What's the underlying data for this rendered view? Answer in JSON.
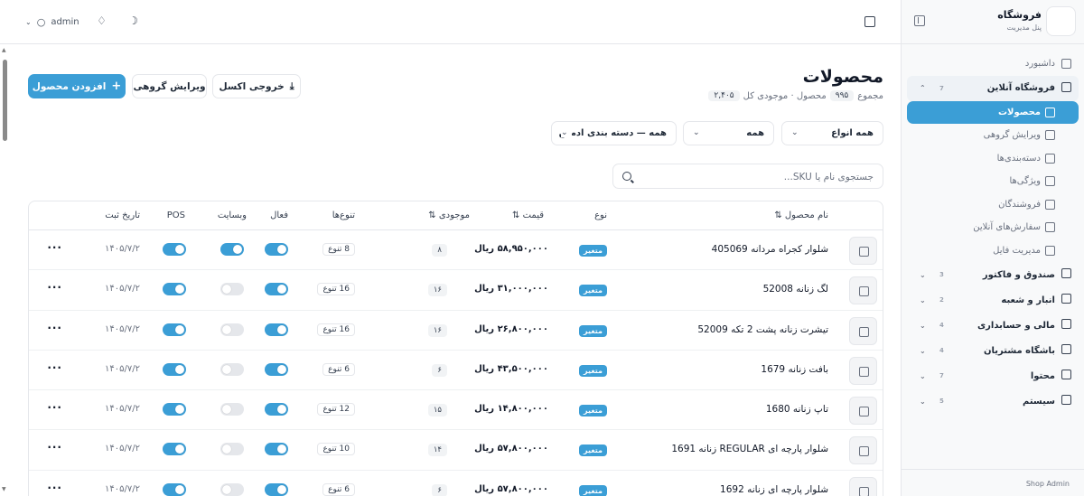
{
  "sidebar": {
    "title": "فروشگاه",
    "subtitle": "پنل مدیریت",
    "footer": "Shop Admin",
    "items": [
      {
        "label": "داشبورد",
        "kind": "top",
        "icon": "dashboard-icon"
      },
      {
        "label": "فروشگاه آنلاین",
        "kind": "group-open",
        "count": "7",
        "icon": "store-icon"
      },
      {
        "label": "محصولات",
        "kind": "active",
        "icon": "box-icon"
      },
      {
        "label": "ویرایش گروهی",
        "kind": "sub",
        "icon": "table-icon"
      },
      {
        "label": "دسته‌بندی‌ها",
        "kind": "sub",
        "icon": "layers-icon"
      },
      {
        "label": "ویژگی‌ها",
        "kind": "sub",
        "icon": "sliders-icon"
      },
      {
        "label": "فروشندگان",
        "kind": "sub",
        "icon": "vendor-icon"
      },
      {
        "label": "سفارش‌های آنلاین",
        "kind": "sub",
        "icon": "cart-icon"
      },
      {
        "label": "مدیریت فایل",
        "kind": "sub",
        "icon": "folder-icon"
      },
      {
        "label": "صندوق و فاکتور",
        "kind": "group",
        "count": "3",
        "icon": "receipt-icon"
      },
      {
        "label": "انبار و شعبه",
        "kind": "group",
        "count": "2",
        "icon": "warehouse-icon"
      },
      {
        "label": "مالی و حسابداری",
        "kind": "group",
        "count": "4",
        "icon": "bank-icon"
      },
      {
        "label": "باشگاه مشتریان",
        "kind": "group",
        "count": "4",
        "icon": "gift-icon"
      },
      {
        "label": "محتوا",
        "kind": "group",
        "count": "7",
        "icon": "document-icon"
      },
      {
        "label": "سیستم",
        "kind": "group",
        "count": "5",
        "icon": "gear-icon"
      }
    ]
  },
  "topbar": {
    "user": "admin"
  },
  "page": {
    "title": "محصولات",
    "summary_prefix": "مجموع",
    "product_count": "۹۹۵",
    "summary_mid": "محصول · موجودی کل",
    "stock_total": "۲,۴۰۵"
  },
  "actions": {
    "add": "افزودن محصول",
    "bulk_edit": "ویرایش گروهی",
    "export": "خروجی اکسل"
  },
  "filters": {
    "types": "همه انواع",
    "status": "همه",
    "category": "همه — دسته بندی ادمین"
  },
  "search": {
    "placeholder": "جستجوی نام یا SKU..."
  },
  "table": {
    "headers": {
      "name": "نام محصول",
      "type": "نوع",
      "price": "قیمت",
      "stock": "موجودی",
      "variants": "تنوع‌ها",
      "active": "فعال",
      "website": "وبسایت",
      "pos": "POS",
      "date": "تاریخ ثبت"
    },
    "rows": [
      {
        "name": "شلوار کجراه مردانه 405069",
        "type": "متغیر",
        "price": "۵۸,۹۵۰,۰۰۰ ریال",
        "stock": "۸",
        "variants": "8 تنوع",
        "active": true,
        "web": true,
        "pos": true,
        "date": "۱۴۰۵/۷/۲"
      },
      {
        "name": "لگ زنانه 52008",
        "type": "متغیر",
        "price": "۳۱,۰۰۰,۰۰۰ ریال",
        "stock": "۱۶",
        "variants": "16 تنوع",
        "active": true,
        "web": false,
        "pos": true,
        "date": "۱۴۰۵/۷/۲"
      },
      {
        "name": "تیشرت زنانه پشت 2 تکه 52009",
        "type": "متغیر",
        "price": "۲۶,۸۰۰,۰۰۰ ریال",
        "stock": "۱۶",
        "variants": "16 تنوع",
        "active": true,
        "web": false,
        "pos": true,
        "date": "۱۴۰۵/۷/۲"
      },
      {
        "name": "بافت زنانه 1679",
        "type": "متغیر",
        "price": "۴۳,۵۰۰,۰۰۰ ریال",
        "stock": "۶",
        "variants": "6 تنوع",
        "active": true,
        "web": false,
        "pos": true,
        "date": "۱۴۰۵/۷/۲"
      },
      {
        "name": "تاپ زنانه 1680",
        "type": "متغیر",
        "price": "۱۴,۸۰۰,۰۰۰ ریال",
        "stock": "۱۵",
        "variants": "12 تنوع",
        "active": true,
        "web": false,
        "pos": true,
        "date": "۱۴۰۵/۷/۲"
      },
      {
        "name": "شلوار پارچه ای REGULAR زنانه 1691",
        "type": "متغیر",
        "price": "۵۷,۸۰۰,۰۰۰ ریال",
        "stock": "۱۴",
        "variants": "10 تنوع",
        "active": true,
        "web": false,
        "pos": true,
        "date": "۱۴۰۵/۷/۲"
      },
      {
        "name": "شلوار پارچه ای زنانه 1692",
        "type": "متغیر",
        "price": "۵۷,۸۰۰,۰۰۰ ریال",
        "stock": "۶",
        "variants": "6 تنوع",
        "active": true,
        "web": false,
        "pos": true,
        "date": "۱۴۰۵/۷/۲"
      }
    ]
  },
  "colors": {
    "accent": "#3b9ed6",
    "border": "#e5e7eb"
  }
}
